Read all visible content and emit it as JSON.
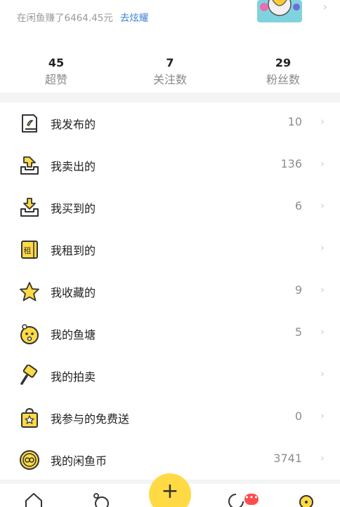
{
  "profile": {
    "earn_text": "在闲鱼赚了6464.45元",
    "earn_link": "去炫耀"
  },
  "stats": [
    {
      "value": "45",
      "label": "超赞"
    },
    {
      "value": "7",
      "label": "关注数"
    },
    {
      "value": "29",
      "label": "粉丝数"
    }
  ],
  "menu": [
    {
      "label": "我发布的",
      "count": "10",
      "icon": "published-doc-icon"
    },
    {
      "label": "我卖出的",
      "count": "136",
      "icon": "sold-upload-icon"
    },
    {
      "label": "我买到的",
      "count": "6",
      "icon": "bought-download-icon"
    },
    {
      "label": "我租到的",
      "count": "",
      "icon": "rent-tag-icon"
    },
    {
      "label": "我收藏的",
      "count": "9",
      "icon": "star-icon"
    },
    {
      "label": "我的鱼塘",
      "count": "5",
      "icon": "fish-pond-icon"
    },
    {
      "label": "我的拍卖",
      "count": "",
      "icon": "auction-hammer-icon"
    },
    {
      "label": "我参与的免费送",
      "count": "0",
      "icon": "free-gift-bag-icon"
    },
    {
      "label": "我的闲鱼币",
      "count": "3741",
      "icon": "fish-coin-icon"
    }
  ],
  "tabbar": {
    "post_symbol": "+",
    "message_badge": "•••"
  },
  "colors": {
    "accent_yellow": "#ffda44",
    "link_blue": "#3d7fd8"
  }
}
